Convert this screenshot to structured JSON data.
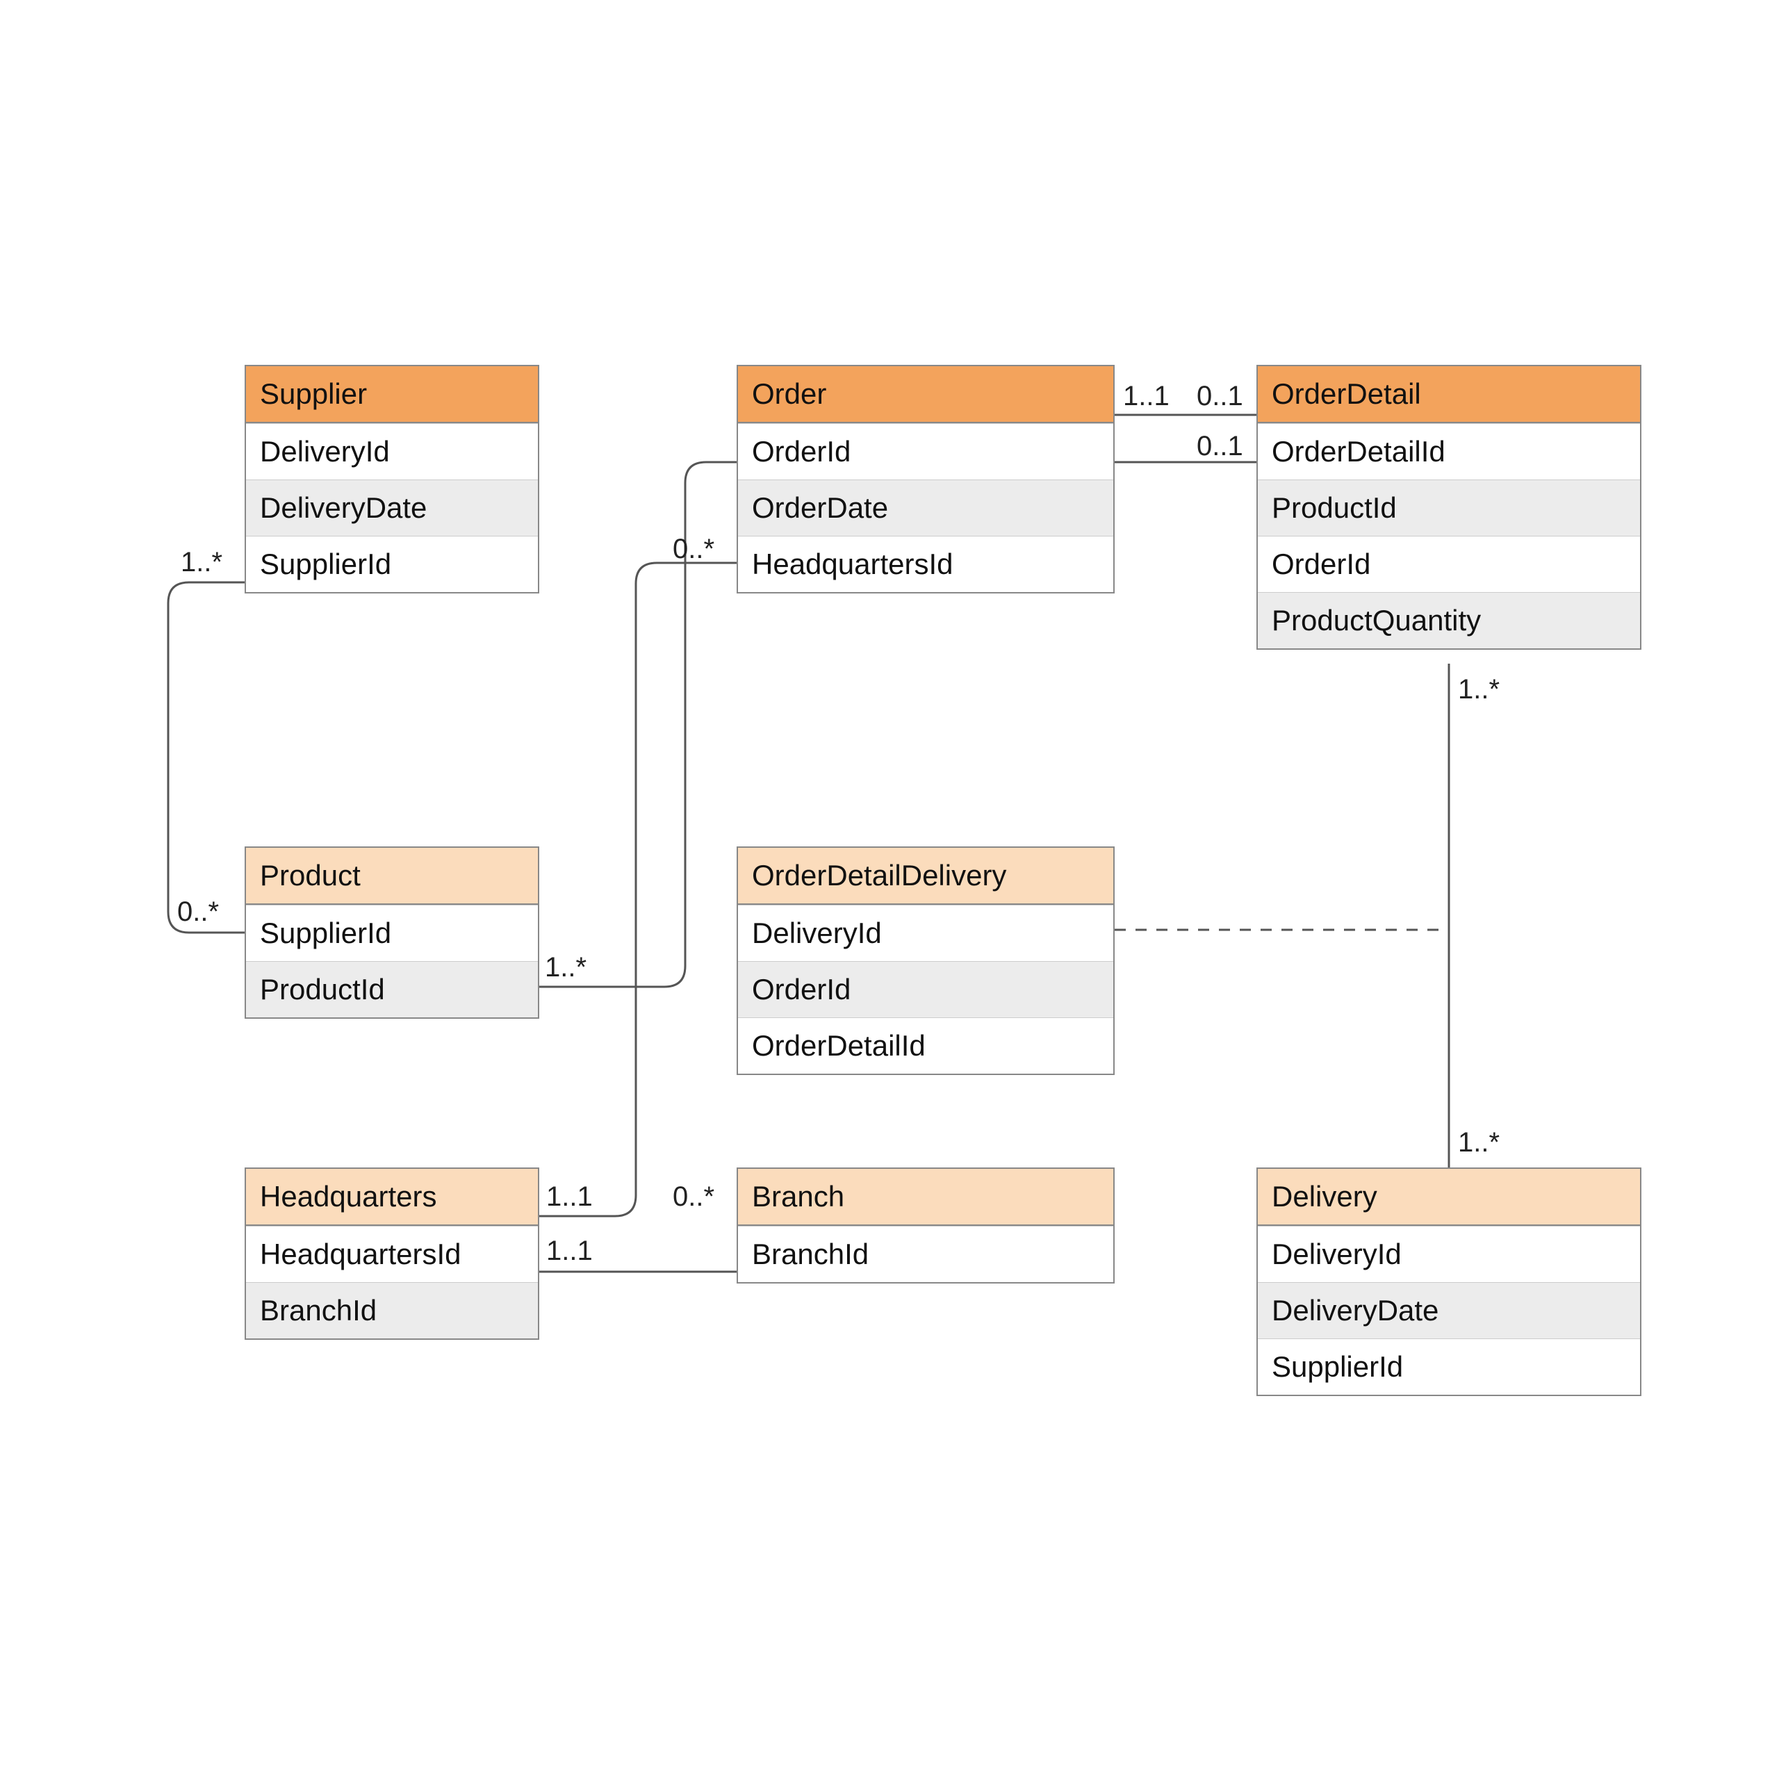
{
  "entities": {
    "supplier": {
      "title": "Supplier",
      "shade": "dark",
      "attrs": [
        "DeliveryId",
        "DeliveryDate",
        "SupplierId"
      ]
    },
    "order": {
      "title": "Order",
      "shade": "dark",
      "attrs": [
        "OrderId",
        "OrderDate",
        "HeadquartersId"
      ]
    },
    "orderDetail": {
      "title": "OrderDetail",
      "shade": "dark",
      "attrs": [
        "OrderDetailId",
        "ProductId",
        "OrderId",
        "ProductQuantity"
      ]
    },
    "product": {
      "title": "Product",
      "shade": "light",
      "attrs": [
        "SupplierId",
        "ProductId"
      ]
    },
    "orderDetailDelivery": {
      "title": "OrderDetailDelivery",
      "shade": "light",
      "attrs": [
        "DeliveryId",
        "OrderId",
        "OrderDetailId"
      ]
    },
    "headquarters": {
      "title": "Headquarters",
      "shade": "light",
      "attrs": [
        "HeadquartersId",
        "BranchId"
      ]
    },
    "branch": {
      "title": "Branch",
      "shade": "light",
      "attrs": [
        "BranchId"
      ]
    },
    "delivery": {
      "title": "Delivery",
      "shade": "light",
      "attrs": [
        "DeliveryId",
        "DeliveryDate",
        "SupplierId"
      ]
    }
  },
  "multiplicities": {
    "supplier_left": "1..*",
    "product_left": "0..*",
    "product_right": "1..*",
    "order_left": "0..*",
    "order_right": "1..1",
    "orderDetail_top_left": "0..1",
    "orderDetail_mid_left": "0..1",
    "orderDetail_bottom": "1..*",
    "delivery_top": "1..*",
    "hq_right_top": "1..1",
    "hq_right_bottom": "1..1",
    "branch_left": "0..*"
  }
}
